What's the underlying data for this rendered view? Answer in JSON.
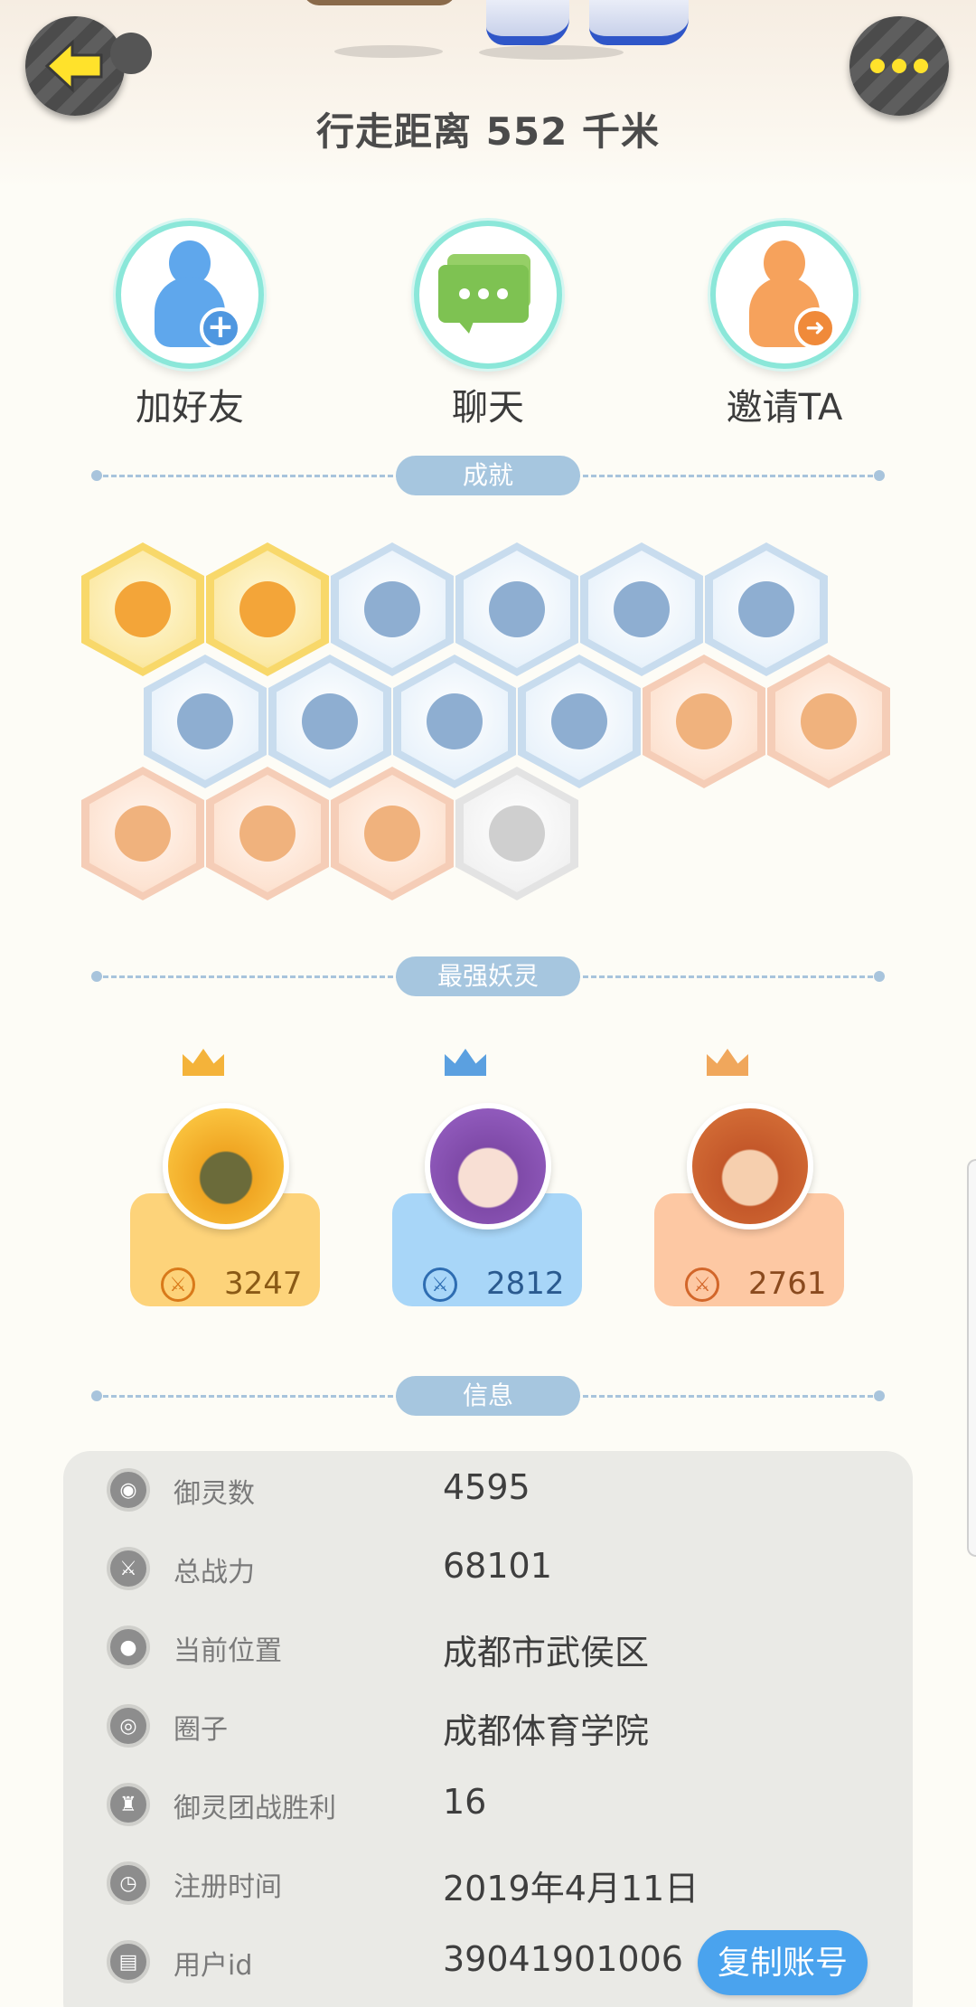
{
  "header": {
    "back_icon": "back-arrow-icon",
    "more_icon": "more-dots-icon",
    "distance_text": "行走距离 552 千米"
  },
  "actions": [
    {
      "label": "加好友",
      "icon": "add-friend-icon"
    },
    {
      "label": "聊天",
      "icon": "chat-icon"
    },
    {
      "label": "邀请TA",
      "icon": "invite-icon"
    }
  ],
  "sections": {
    "achievements": "成就",
    "strongest": "最强妖灵",
    "info": "信息"
  },
  "achievements": {
    "rows": [
      [
        "gold",
        "gold",
        "blue",
        "blue",
        "blue",
        "blue"
      ],
      [
        "blue",
        "blue",
        "blue",
        "blue",
        "peach",
        "peach"
      ],
      [
        "peach",
        "peach",
        "peach",
        "grey"
      ]
    ]
  },
  "pets": [
    {
      "power": "3247",
      "rank_color": "#f4b33a"
    },
    {
      "power": "2812",
      "rank_color": "#5ba0e0"
    },
    {
      "power": "2761",
      "rank_color": "#f0a75c"
    }
  ],
  "info": {
    "rows": [
      {
        "key": "御灵数",
        "value": "4595",
        "icon": "pet-icon"
      },
      {
        "key": "总战力",
        "value": "68101",
        "icon": "sword-icon"
      },
      {
        "key": "当前位置",
        "value": "成都市武侯区",
        "icon": "location-icon"
      },
      {
        "key": "圈子",
        "value": "成都体育学院",
        "icon": "circle-icon"
      },
      {
        "key": "御灵团战胜利",
        "value": "16",
        "icon": "trophy-icon"
      },
      {
        "key": "注册时间",
        "value": "2019年4月11日",
        "icon": "clock-icon"
      },
      {
        "key": "用户id",
        "value": "39041901006",
        "icon": "id-icon"
      }
    ],
    "copy_button": "复制账号"
  },
  "colors": {
    "accent_blue": "#4aa3ee",
    "section_pill": "#a6c6df",
    "background": "#fdfcf6"
  }
}
